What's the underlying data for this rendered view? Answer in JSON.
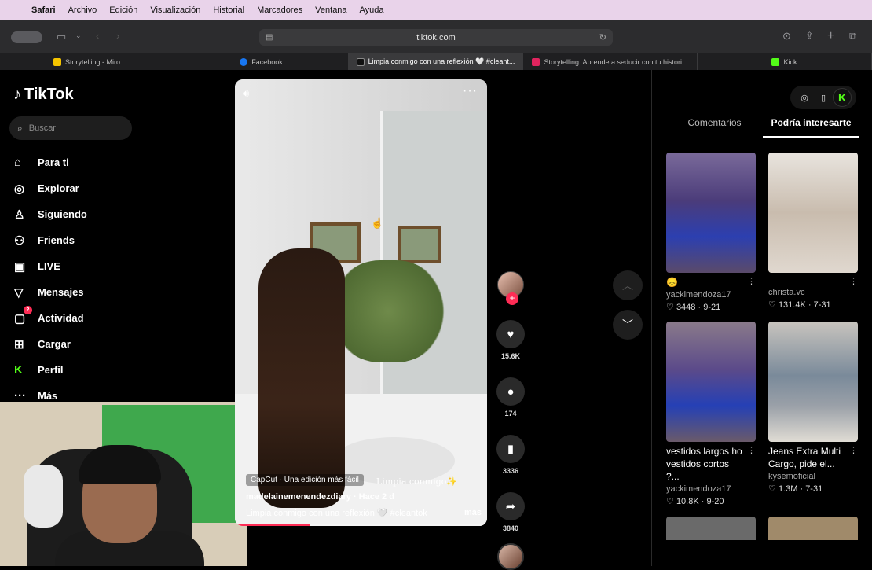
{
  "menubar": {
    "app": "Safari",
    "items": [
      "Archivo",
      "Edición",
      "Visualización",
      "Historial",
      "Marcadores",
      "Ventana",
      "Ayuda"
    ]
  },
  "toolbar": {
    "url": "tiktok.com"
  },
  "tabs": [
    {
      "label": "Storytelling - Miro",
      "color": "#f5c400"
    },
    {
      "label": "Facebook",
      "color": "#1877f2"
    },
    {
      "label": "Limpia conmigo con una reflexión 🤍 #cleant...",
      "color": "#222222",
      "active": true
    },
    {
      "label": "Storytelling. Aprende a seducir con tu histori...",
      "color": "#e0245e"
    },
    {
      "label": "Kick",
      "color": "#53fc18"
    }
  ],
  "tiktok": {
    "logo": "TikTok",
    "search_placeholder": "Buscar",
    "nav": [
      {
        "label": "Para ti",
        "icon": "home-icon",
        "glyph": "⌂"
      },
      {
        "label": "Explorar",
        "icon": "compass-icon",
        "glyph": "◎"
      },
      {
        "label": "Siguiendo",
        "icon": "user-follow-icon",
        "glyph": "👤"
      },
      {
        "label": "Friends",
        "icon": "friends-icon",
        "glyph": "👥"
      },
      {
        "label": "LIVE",
        "icon": "live-icon",
        "glyph": "▣"
      },
      {
        "label": "Mensajes",
        "icon": "send-icon",
        "glyph": "▽"
      },
      {
        "label": "Actividad",
        "icon": "inbox-icon",
        "glyph": "▢",
        "badge": "2"
      },
      {
        "label": "Cargar",
        "icon": "upload-icon",
        "glyph": "⊞"
      },
      {
        "label": "Perfil",
        "icon": "profile-kick-icon",
        "glyph": "K"
      },
      {
        "label": "Más",
        "icon": "more-icon",
        "glyph": "···"
      }
    ]
  },
  "video": {
    "capcut": "CapCut · Una edición más fácil",
    "author": "madelainemenendezdiary",
    "time": "· Hace 2 d",
    "description": "Limpia conmigo con una reflexión 🤍 #cleantok",
    "more": "más",
    "overlay_text": "Limpia conmigo✨",
    "progress": 0.3
  },
  "actions": {
    "likes": "15.6K",
    "comments": "174",
    "saves": "3336",
    "shares": "3840"
  },
  "right_panel": {
    "tabs": [
      "Comentarios",
      "Podría interesarte"
    ],
    "active_tab": 1,
    "cards": [
      {
        "title": "😞",
        "user": "yackimendoza17",
        "likes": "3448",
        "date": "9-21"
      },
      {
        "title": "",
        "user": "christa.vc",
        "likes": "131.4K",
        "date": "7-31"
      },
      {
        "title": "vestidos largos ho vestidos cortos ?...",
        "user": "yackimendoza17",
        "likes": "10.8K",
        "date": "9-20"
      },
      {
        "title": "Jeans Extra Multi Cargo, pide el...",
        "user": "kysemoficial",
        "likes": "1.3M",
        "date": "7-31"
      }
    ]
  }
}
